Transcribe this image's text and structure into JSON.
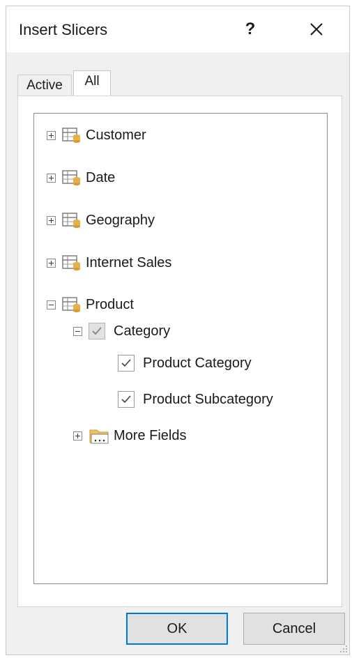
{
  "dialog": {
    "title": "Insert Slicers",
    "help_label": "?",
    "close_icon": "close-icon"
  },
  "tabs": [
    {
      "label": "Active",
      "selected": false
    },
    {
      "label": "All",
      "selected": true
    }
  ],
  "tree": {
    "tables": [
      {
        "label": "Customer",
        "expanded": false,
        "icon": "table-icon"
      },
      {
        "label": "Date",
        "expanded": false,
        "icon": "table-icon"
      },
      {
        "label": "Geography",
        "expanded": false,
        "icon": "table-icon"
      },
      {
        "label": "Internet Sales",
        "expanded": false,
        "icon": "table-icon"
      },
      {
        "label": "Product",
        "expanded": true,
        "icon": "table-icon"
      }
    ],
    "hierarchy": {
      "label": "Category",
      "expanded": true,
      "checked": "partial-gray"
    },
    "fields": [
      {
        "label": "Product Category",
        "checked": true
      },
      {
        "label": "Product Subcategory",
        "checked": true
      }
    ],
    "more_fields": {
      "label": "More Fields",
      "expanded": false,
      "icon": "folder-icon"
    }
  },
  "buttons": {
    "ok": "OK",
    "cancel": "Cancel"
  },
  "colors": {
    "accent": "#0078d7",
    "table_icon_gold": "#e8b04b"
  }
}
